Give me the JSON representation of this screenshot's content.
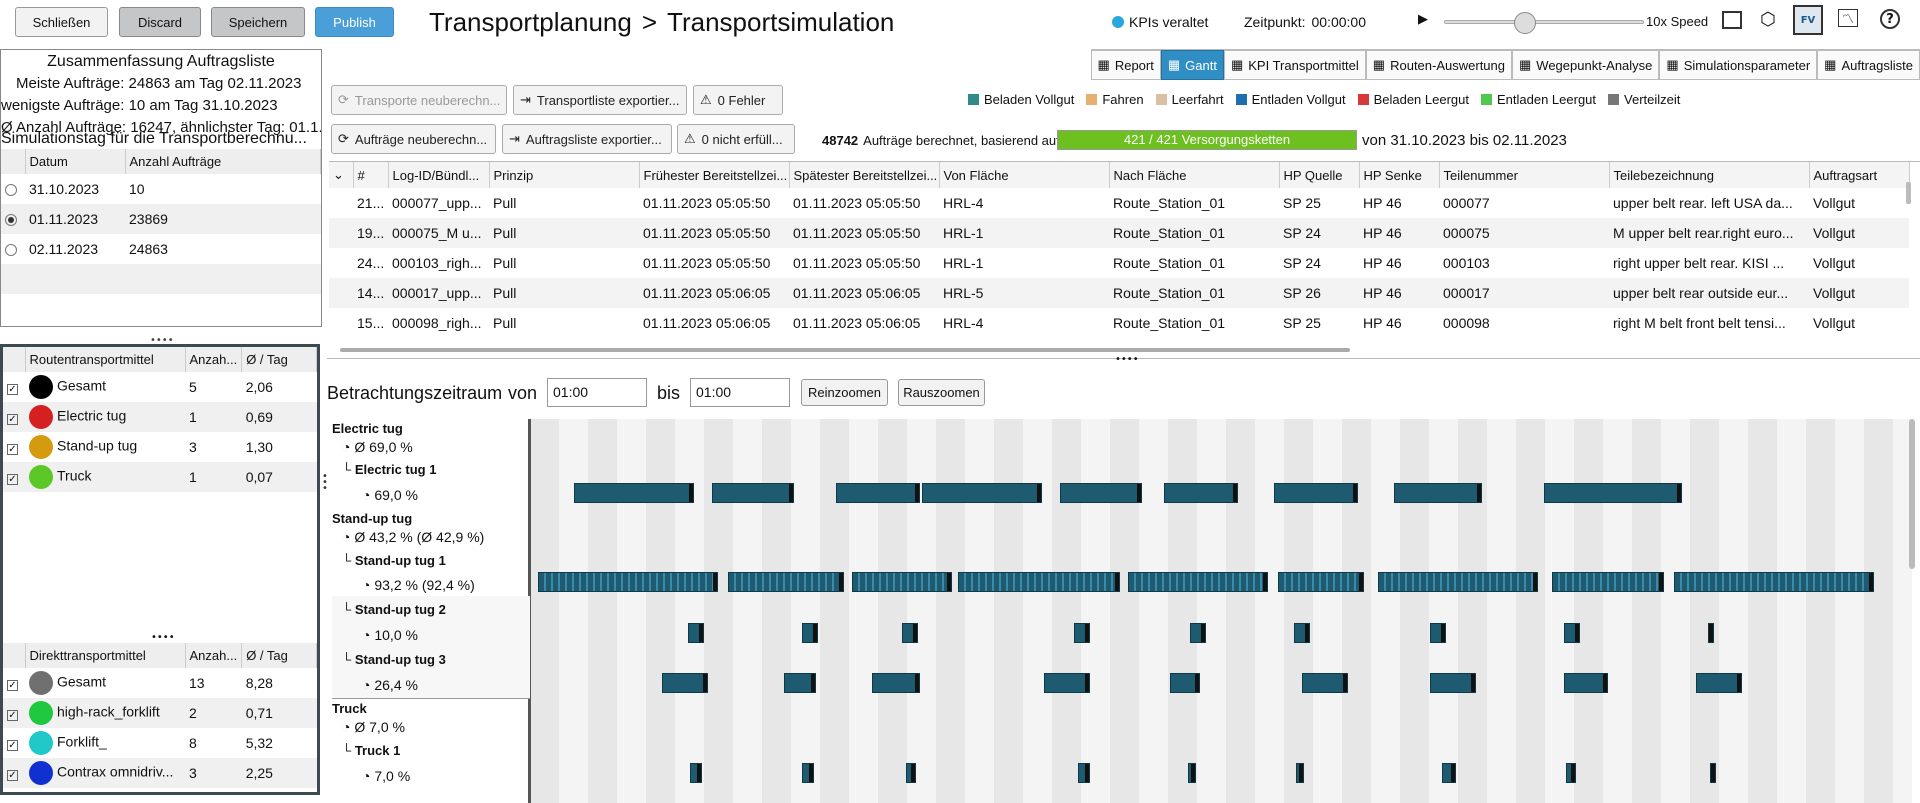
{
  "toolbar": {
    "close": "Schließen",
    "discard": "Discard",
    "save": "Speichern",
    "publish": "Publish"
  },
  "title": {
    "parent": "Transportplanung",
    "separator": ">",
    "current": "Transportsimulation"
  },
  "status": {
    "kpi": "KPIs veraltet",
    "time_label": "Zeitpunkt:",
    "time_value": "00:00:00",
    "speed": "10x Speed",
    "speed_fraction": 0.4
  },
  "summary": {
    "title": "Zusammenfassung Auftragsliste",
    "most": "Meiste Aufträge: 24863 am Tag 02.11.2023",
    "least": "wenigste Aufträge: 10 am Tag 31.10.2023",
    "avg": "Ø Anzahl Aufträge: 16247, ähnlichster Tag: 01.1...",
    "sim_day": "Simulationstag für die Transportberechnu..."
  },
  "days": {
    "headers": [
      "Datum",
      "Anzahl Aufträge"
    ],
    "rows": [
      {
        "date": "31.10.2023",
        "count": "10",
        "selected": false
      },
      {
        "date": "01.11.2023",
        "count": "23869",
        "selected": true
      },
      {
        "date": "02.11.2023",
        "count": "24863",
        "selected": false
      }
    ]
  },
  "routes": {
    "headers": [
      "Routentransportmittel",
      "Anzah...",
      "Ø / Tag"
    ],
    "rows": [
      {
        "name": "Gesamt",
        "count": "5",
        "avg": "2,06",
        "color": "#000000"
      },
      {
        "name": "Electric tug",
        "count": "1",
        "avg": "0,69",
        "color": "#d42020"
      },
      {
        "name": "Stand-up tug",
        "count": "3",
        "avg": "1,30",
        "color": "#d49a10"
      },
      {
        "name": "Truck",
        "count": "1",
        "avg": "0,07",
        "color": "#5cc828"
      }
    ]
  },
  "direct": {
    "headers": [
      "Direkttransportmittel",
      "Anzah...",
      "Ø / Tag"
    ],
    "rows": [
      {
        "name": "Gesamt",
        "count": "13",
        "avg": "8,28",
        "color": "#707070"
      },
      {
        "name": "high-rack_forklift",
        "count": "2",
        "avg": "0,71",
        "color": "#20c840"
      },
      {
        "name": "Forklift_",
        "count": "8",
        "avg": "5,32",
        "color": "#20c8c8"
      },
      {
        "name": "Contrax omnidriv...",
        "count": "3",
        "avg": "2,25",
        "color": "#1030d0"
      }
    ]
  },
  "tabs": [
    {
      "label": "Report",
      "icon": "report-icon"
    },
    {
      "label": "Gantt",
      "icon": "gantt-icon",
      "active": true
    },
    {
      "label": "KPI Transportmittel",
      "icon": "kpi-icon"
    },
    {
      "label": "Routen-Auswertung",
      "icon": "route-icon"
    },
    {
      "label": "Wegepunkt-Analyse",
      "icon": "waypoint-icon"
    },
    {
      "label": "Simulationsparameter",
      "icon": "params-icon"
    },
    {
      "label": "Auftragsliste",
      "icon": "orders-icon"
    }
  ],
  "actions": {
    "recalc_transports": "Transporte neuberechn...",
    "export_transports": "Transportliste exportier...",
    "errors": "0 Fehler",
    "recalc_orders": "Aufträge neuberechn...",
    "export_orders": "Auftragsliste exportier...",
    "unfulfilled": "0 nicht erfüll..."
  },
  "legend": [
    {
      "label": "Beladen Vollgut",
      "color": "#2f8a8a"
    },
    {
      "label": "Fahren",
      "color": "#e8b070"
    },
    {
      "label": "Leerfahrt",
      "color": "#d8c0a0"
    },
    {
      "label": "Entladen Vollgut",
      "color": "#1f6fb0"
    },
    {
      "label": "Beladen Leergut",
      "color": "#d83838"
    },
    {
      "label": "Entladen Leergut",
      "color": "#50c850"
    },
    {
      "label": "Verteilzeit",
      "color": "#777777"
    }
  ],
  "orders_info": {
    "count": "48742",
    "text": "Aufträge berechnet, basierend auf:",
    "progress": "421 / 421 Versorgungsketten",
    "progress_fraction": 1.0,
    "range": "von 31.10.2023 bis 02.11.2023"
  },
  "orders_table": {
    "headers": [
      "#",
      "Log-ID/Bündl...",
      "Prinzip",
      "Frühester Bereitstellzei...",
      "Spätester Bereitstellzei...",
      "Von Fläche",
      "Nach Fläche",
      "HP Quelle",
      "HP Senke",
      "Teilenummer",
      "Teilebezeichnung",
      "Auftragsart"
    ],
    "rows": [
      [
        "21...",
        "000077_upp...",
        "Pull",
        "01.11.2023 05:05:50",
        "01.11.2023 05:05:50",
        "HRL-4",
        "Route_Station_01",
        "SP 25",
        "HP 46",
        "000077",
        "upper belt rear. left USA da...",
        "Vollgut"
      ],
      [
        "19...",
        "000075_M u...",
        "Pull",
        "01.11.2023 05:05:50",
        "01.11.2023 05:05:50",
        "HRL-1",
        "Route_Station_01",
        "SP 24",
        "HP 46",
        "000075",
        "M upper belt rear.right euro...",
        "Vollgut"
      ],
      [
        "24...",
        "000103_righ...",
        "Pull",
        "01.11.2023 05:05:50",
        "01.11.2023 05:05:50",
        "HRL-1",
        "Route_Station_01",
        "SP 24",
        "HP 46",
        "000103",
        "right upper belt rear. KISI ...",
        "Vollgut"
      ],
      [
        "14...",
        "000017_upp...",
        "Pull",
        "01.11.2023 05:06:05",
        "01.11.2023 05:06:05",
        "HRL-5",
        "Route_Station_01",
        "SP 26",
        "HP 46",
        "000017",
        "upper belt rear outside eur...",
        "Vollgut"
      ],
      [
        "15...",
        "000098_righ...",
        "Pull",
        "01.11.2023 05:06:05",
        "01.11.2023 05:06:05",
        "HRL-4",
        "Route_Station_01",
        "SP 25",
        "HP 46",
        "000098",
        "right M belt front  belt tensi...",
        "Vollgut"
      ]
    ]
  },
  "period": {
    "label": "Betrachtungszeitraum",
    "from_label": "von",
    "from": "01:00",
    "to_label": "bis",
    "to": "01:00",
    "zoom_in": "Reinzoomen",
    "zoom_out": "Rauszoomen"
  },
  "gantt": {
    "electric": {
      "group": "Electric tug",
      "avg": "Ø 69,0 %",
      "item": "Electric tug 1",
      "item_val": "69,0 %"
    },
    "standup": {
      "group": "Stand-up tug",
      "avg": "Ø 43,2 % (Ø 42,9 %)",
      "item1": "Stand-up tug 1",
      "val1": "93,2 % (92,4 %)",
      "item2": "Stand-up tug 2",
      "val2": "10,0 %",
      "item3": "Stand-up tug 3",
      "val3": "26,4 %"
    },
    "truck": {
      "group": "Truck",
      "avg": "Ø 7,0 %",
      "item": "Truck 1",
      "item_val": "7,0 %"
    }
  }
}
